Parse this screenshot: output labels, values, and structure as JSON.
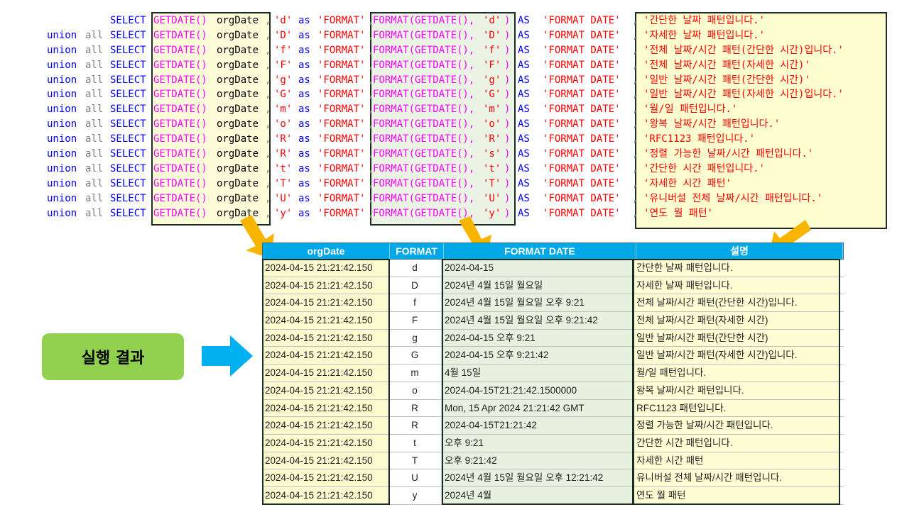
{
  "code": {
    "keywords": {
      "union": "union",
      "all": "all",
      "select": "SELECT",
      "getdate": "GETDATE()",
      "orgdate": "orgDate",
      "comma": ",",
      "as": "as",
      "format_label": "'FORMAT'",
      "format_fn_open": "FORMAT(GETDATE(), ",
      "as_upper": "AS",
      "format_date_label": "'FORMAT DATE'"
    },
    "lines": [
      {
        "fmt": "'d'",
        "desc": "'간단한 날짜 패턴입니다.'"
      },
      {
        "fmt": "'D'",
        "desc": "'자세한 날짜 패턴입니다.'"
      },
      {
        "fmt": "'f'",
        "desc": "'전체 날짜/시간 패턴(간단한 시간)입니다.'"
      },
      {
        "fmt": "'F'",
        "desc": "'전체 날짜/시간 패턴(자세한 시간)'"
      },
      {
        "fmt": "'g'",
        "desc": "'일반 날짜/시간 패턴(간단한 시간)'"
      },
      {
        "fmt": "'G'",
        "desc": "'일반 날짜/시간 패턴(자세한 시간)입니다.'"
      },
      {
        "fmt": "'m'",
        "desc": "'월/일 패턴입니다.'"
      },
      {
        "fmt": "'o'",
        "desc": "'왕복 날짜/시간 패턴입니다.'"
      },
      {
        "fmt": "'R'",
        "fmt2": "'R'",
        "desc": "'RFC1123 패턴입니다.'"
      },
      {
        "fmt": "'R'",
        "fmt2": "'s'",
        "desc": "'정렬 가능한 날짜/시간 패턴입니다.'"
      },
      {
        "fmt": "'t'",
        "desc": "'간단한 시간 패턴입니다.'"
      },
      {
        "fmt": "'T'",
        "desc": "'자세한 시간 패턴'"
      },
      {
        "fmt": "'U'",
        "desc": "'유니버설 전체 날짜/시간 패턴입니다.'"
      },
      {
        "fmt": "'y'",
        "desc": "'연도 월 패턴'"
      }
    ]
  },
  "result_label": "실행 결과",
  "table": {
    "headers": [
      "orgDate",
      "FORMAT",
      "FORMAT DATE",
      "설명"
    ],
    "rows": [
      [
        "2024-04-15 21:21:42.150",
        "d",
        "2024-04-15",
        "간단한 날짜 패턴입니다."
      ],
      [
        "2024-04-15 21:21:42.150",
        "D",
        "2024년 4월 15일 월요일",
        "자세한 날짜 패턴입니다."
      ],
      [
        "2024-04-15 21:21:42.150",
        "f",
        "2024년 4월 15일 월요일 오후 9:21",
        "전체 날짜/시간 패턴(간단한 시간)입니다."
      ],
      [
        "2024-04-15 21:21:42.150",
        "F",
        "2024년 4월 15일 월요일 오후 9:21:42",
        "전체 날짜/시간 패턴(자세한 시간)"
      ],
      [
        "2024-04-15 21:21:42.150",
        "g",
        "2024-04-15 오후 9:21",
        "일반 날짜/시간 패턴(간단한 시간)"
      ],
      [
        "2024-04-15 21:21:42.150",
        "G",
        "2024-04-15 오후 9:21:42",
        "일반 날짜/시간 패턴(자세한 시간)입니다."
      ],
      [
        "2024-04-15 21:21:42.150",
        "m",
        "4월 15일",
        "월/일 패턴입니다."
      ],
      [
        "2024-04-15 21:21:42.150",
        "o",
        "2024-04-15T21:21:42.1500000",
        "왕복 날짜/시간 패턴입니다."
      ],
      [
        "2024-04-15 21:21:42.150",
        "R",
        "Mon, 15 Apr 2024 21:21:42 GMT",
        "RFC1123 패턴입니다."
      ],
      [
        "2024-04-15 21:21:42.150",
        "R",
        "2024-04-15T21:21:42",
        "정렬 가능한 날짜/시간 패턴입니다."
      ],
      [
        "2024-04-15 21:21:42.150",
        "t",
        "오후 9:21",
        "간단한 시간 패턴입니다."
      ],
      [
        "2024-04-15 21:21:42.150",
        "T",
        "오후 9:21:42",
        "자세한 시간 패턴"
      ],
      [
        "2024-04-15 21:21:42.150",
        "U",
        "2024년 4월 15일 월요일 오후 12:21:42",
        "유니버설 전체 날짜/시간 패턴입니다."
      ],
      [
        "2024-04-15 21:21:42.150",
        "y",
        "2024년 4월",
        "연도 월 패턴"
      ]
    ]
  },
  "colors": {
    "header_bg": "#00a8e8",
    "result_label_bg": "#92d050",
    "arrow_orange": "#f7b500",
    "arrow_blue": "#00b0f0"
  }
}
